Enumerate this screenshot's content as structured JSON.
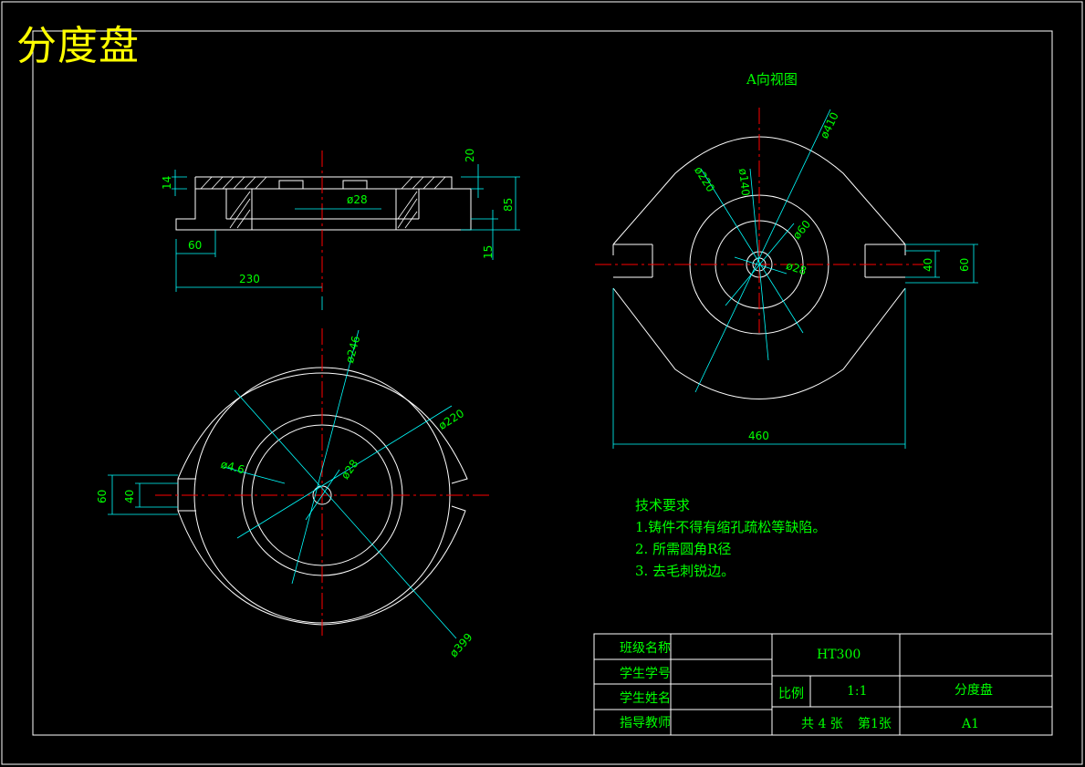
{
  "drawing_title": "分度盘",
  "view_a_title": "A向视图",
  "dimensions": {
    "sec_14": "14",
    "sec_20": "20",
    "sec_85": "85",
    "sec_15": "15",
    "sec_d28": "ø28",
    "sec_60": "60",
    "sec_230": "230",
    "top_d410": "ø410",
    "top_d220": "ø220",
    "top_d140": "ø140",
    "top_d60": "ø60",
    "top_d28": "ø28",
    "top_40": "40",
    "top_60": "60",
    "top_460": "460",
    "bot_d246": "ø246",
    "bot_d220": "ø220",
    "bot_d46": "ø4.6",
    "bot_d28": "ø28",
    "bot_d399": "ø399",
    "bot_60": "60",
    "bot_40": "40"
  },
  "technical_requirements": {
    "heading": "技术要求",
    "items": [
      "1.铸件不得有缩孔疏松等缺陷。",
      "2. 所需圆角R径",
      "3. 去毛刺锐边。"
    ]
  },
  "title_block": {
    "class_name": "班级名称",
    "student_id": "学生学号",
    "student_name": "学生姓名",
    "instructor": "指导教师",
    "material": "HT300",
    "scale_label": "比例",
    "scale_value": "1:1",
    "sheets": "共 4 张",
    "sheet_no": "第1张",
    "part_name": "分度盘",
    "paper_size": "A1"
  },
  "colors": {
    "outline": "#ffffff",
    "dimension": "#00ffff",
    "centerline": "#ff0000",
    "text": "#00ff00",
    "title": "#ffff00"
  }
}
